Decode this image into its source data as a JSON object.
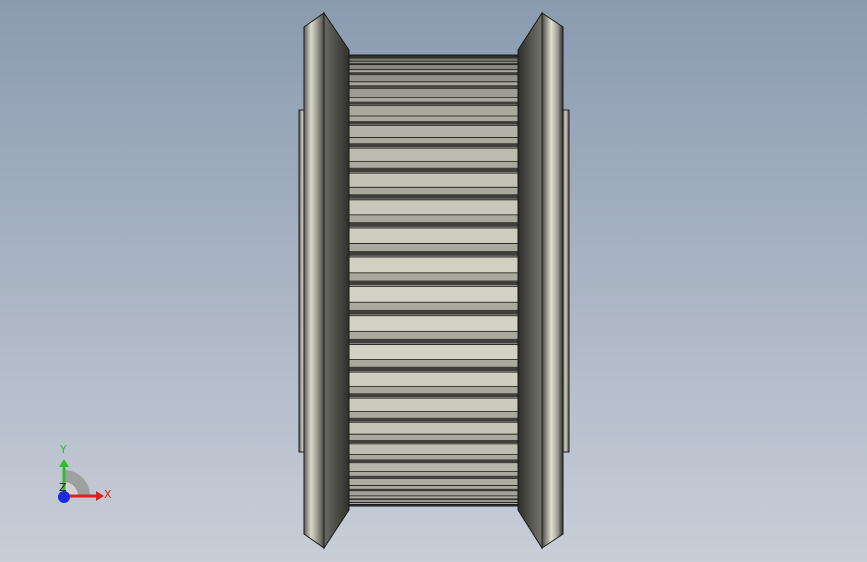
{
  "viewport": {
    "background_top": "#8a9bb0",
    "background_bottom": "#c9ced8"
  },
  "model": {
    "part": "timing-pulley",
    "view": "front",
    "tooth_count_visible": 24,
    "colors": {
      "metal_light": "#e4e3d4",
      "metal_mid": "#a9a99d",
      "metal_dark": "#3e3e3a",
      "edge": "#1a1a1a"
    }
  },
  "triad": {
    "x_label": "X",
    "y_label": "Y",
    "z_label": "Z",
    "x_color": "#e0201a",
    "y_color": "#2fbf2a",
    "z_color": "#1a2ee0"
  }
}
